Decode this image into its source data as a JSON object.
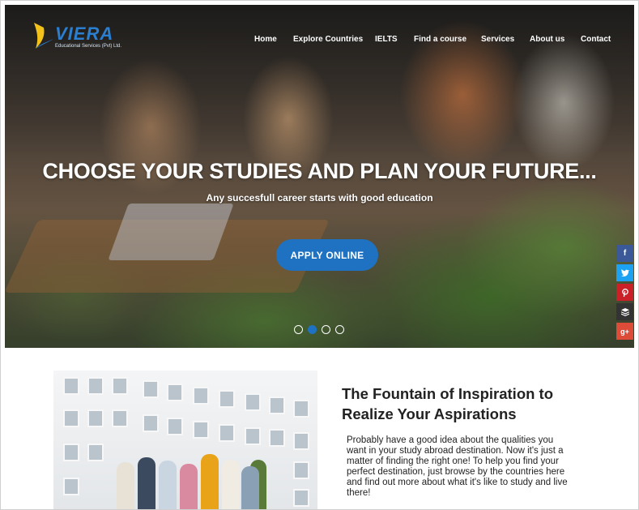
{
  "brand": {
    "name": "VIERA",
    "tagline": "Educational Services (Pvt) Ltd."
  },
  "nav": {
    "items": [
      "Home",
      "Explore Countries",
      "IELTS",
      "Find a course",
      "Services",
      "About us",
      "Contact"
    ]
  },
  "hero": {
    "title": "CHOOSE YOUR STUDIES AND PLAN YOUR FUTURE...",
    "subtitle": "Any succesfull career starts with good education",
    "cta_label": "APPLY ONLINE",
    "slides_total": 4,
    "active_slide": 2
  },
  "social": {
    "items": [
      {
        "icon": "facebook-icon",
        "glyph": "f",
        "color": "#3b5998"
      },
      {
        "icon": "twitter-icon",
        "glyph": "t",
        "color": "#1da1f2"
      },
      {
        "icon": "pinterest-icon",
        "glyph": "p",
        "color": "#cb2027"
      },
      {
        "icon": "buffer-icon",
        "glyph": "≡",
        "color": "#333333"
      },
      {
        "icon": "google-plus-icon",
        "glyph": "g+",
        "color": "#dd4b39"
      }
    ]
  },
  "about": {
    "heading": "The Fountain of Inspiration to Realize Your Aspirations",
    "body": "Probably have a good idea about the qualities you want in your study abroad destination. Now it's just a matter of finding the right one! To help you find your perfect destination, just browse by the countries here and find out more about what it's like to study and live there!"
  },
  "colors": {
    "accent": "#1f72c2",
    "nav_text": "#ffffff",
    "heading_text": "#222222"
  }
}
